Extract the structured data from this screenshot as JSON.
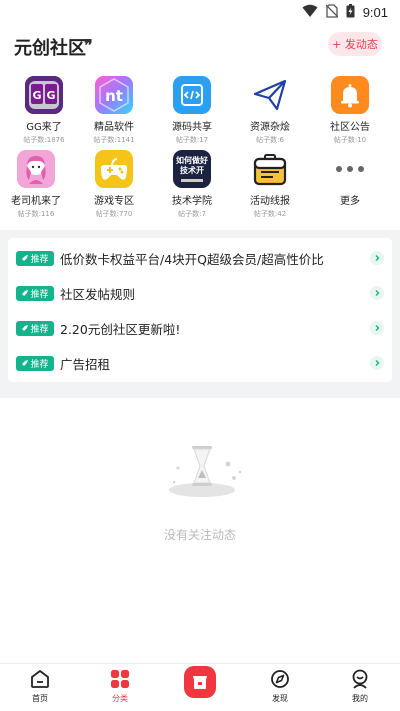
{
  "status_bar": {
    "time": "9:01",
    "icons": [
      "wifi-icon",
      "no-sim-icon",
      "battery-icon"
    ]
  },
  "header": {
    "title": "元创社区",
    "quote_glyph": "❞",
    "post_button": "+ 发动态"
  },
  "categories": [
    {
      "name": "GG来了",
      "count": "帖子数:1876",
      "icon": "gg-app-icon"
    },
    {
      "name": "精品软件",
      "count": "帖子数:1141",
      "icon": "nt-app-icon"
    },
    {
      "name": "源码共享",
      "count": "帖子数:17",
      "icon": "code-icon"
    },
    {
      "name": "资源杂烩",
      "count": "帖子数:6",
      "icon": "paper-plane-icon"
    },
    {
      "name": "社区公告",
      "count": "帖子数:10",
      "icon": "bell-icon"
    },
    {
      "name": "老司机来了",
      "count": "帖子数:116",
      "icon": "girl-avatar-icon"
    },
    {
      "name": "游戏专区",
      "count": "帖子数:770",
      "icon": "gamepad-icon"
    },
    {
      "name": "技术学院",
      "count": "帖子数:7",
      "icon": "tech-book-icon",
      "icon_text": [
        "如何做好",
        "技术开"
      ]
    },
    {
      "name": "活动线报",
      "count": "帖子数:42",
      "icon": "briefcase-icon"
    },
    {
      "name": "更多",
      "count": "",
      "icon": "more-dots-icon"
    }
  ],
  "recommendations": {
    "badge_label": "推荐",
    "items": [
      "低价数卡权益平台/4块开Q超级会员/超高性价比",
      "社区发帖规则",
      "2.20元创社区更新啦!",
      "广告招租"
    ]
  },
  "empty_state": {
    "text": "没有关注动态"
  },
  "tabbar": {
    "items": [
      {
        "label": "首页",
        "icon": "home-icon"
      },
      {
        "label": "分类",
        "icon": "category-grid-icon",
        "active": true
      },
      {
        "label": "",
        "icon": "store-icon"
      },
      {
        "label": "发现",
        "icon": "compass-icon"
      },
      {
        "label": "我的",
        "icon": "profile-icon"
      }
    ]
  },
  "colors": {
    "accent": "#f0373f",
    "recommend_badge": "#13b38b",
    "post_button_bg": "#fde7ea",
    "post_button_text": "#ef3a50"
  }
}
